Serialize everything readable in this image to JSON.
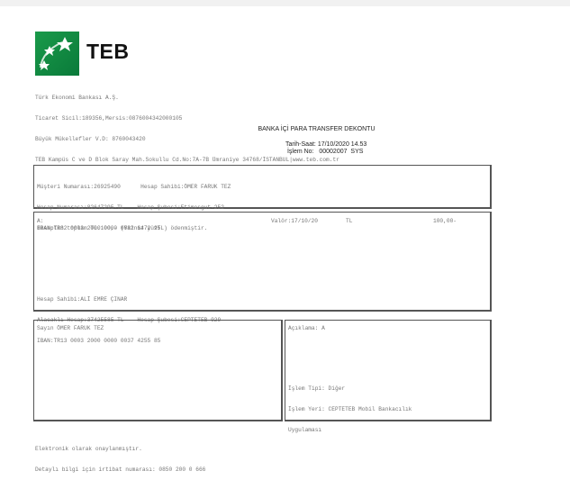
{
  "brand": {
    "name": "TEB",
    "color": "#1a9a4a"
  },
  "company": [
    "Türk Ekonomi Bankası A.Ş.",
    "Ticaret Sicil:189356,Mersis:0876004342000105",
    "Büyük Mükellefler V.D: 8760043420",
    "TEB Kampüs C ve D Blok Saray Mah.Sokullu Cd.No:7A-7B Ümraniye 34768/İSTANBUL|www.teb.com.tr"
  ],
  "title": "BANKA İÇİ PARA TRANSFER DEKONTU",
  "meta": {
    "datetime_label": "Tarih-Saat:",
    "datetime": "17/10/2020 14.53",
    "txn_label": "İşlem No:",
    "txn": "00002007  SYS"
  },
  "sender": {
    "line1": "Müşteri Numarası:26925490      Hesap Sahibi:ÖMER FARUK TEZ",
    "line2": "Hesap Numarası:82647295-TL    Hesap Şubesi:Etimesgut-252",
    "line3": "IBAN:TR82 0003 2000 0000 0082 6472 95"
  },
  "transfer": {
    "to": "A:",
    "value_date": "Valör:17/10/20",
    "currency": "TL",
    "amount": "100,00-",
    "note": "Hesaptan toplam TL.100,- (Yalnız yüzTL) ödenmiştir.",
    "line1": "Hesap Sahibi:ALİ EMRE ÇINAR",
    "line2": "Alacaklı Hesap:37425585-TL    Hesap Şubesi:CEPTETEB-929",
    "line3": "IBAN:TR13 0003 2000 0000 0037 4255 85"
  },
  "recipient_box": {
    "text": "Sayın ÖMER FARUK TEZ"
  },
  "desc_box": {
    "desc": "Açıklama: A",
    "type": "İşlem Tipi: Diğer",
    "place": "İşlem Yeri: CEPTETEB Mobil Bankacılık",
    "place2": "Uygulaması"
  },
  "footer": [
    "Elektronik olarak onaylanmıştır.",
    "Detaylı bilgi için irtibat numarası: 0850 200 0 666"
  ]
}
